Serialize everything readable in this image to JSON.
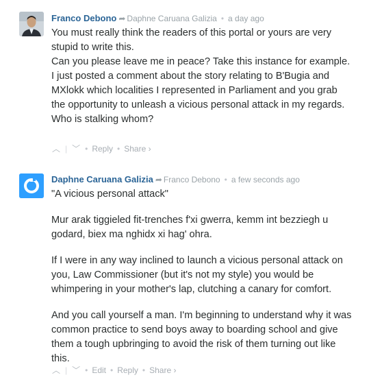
{
  "comments": [
    {
      "author": "Franco Debono",
      "reply_to": "Daphne Caruana Galizia",
      "time": "a day ago",
      "avatar_icon": "user-photo",
      "paragraphs": [
        "You must really think the readers of this portal or yours are very stupid to write this.\nCan you please leave me in peace? Take this instance for example. I just posted a comment about the story relating to B'Bugia and MXlokk which localities I represented in Parliament and you grab the opportunity to unleash a vicious personal attack in my regards.\nWho is stalking whom?"
      ],
      "actions": {
        "reply": "Reply",
        "share": "Share ›"
      }
    },
    {
      "author": "Daphne Caruana Galizia",
      "reply_to": "Franco Debono",
      "time": "a few seconds ago",
      "avatar_icon": "disqus-logo",
      "paragraphs": [
        "\"A vicious personal attack\"",
        "Mur arak tiggieled fit-trenches f'xi gwerra, kemm int bezziegh u godard, biex ma nghidx xi hag' ohra.",
        "If I were in any way inclined to launch a vicious personal attack on you, Law Commissioner (but it's not my style) you would be whimpering in your mother's lap, clutching a canary for comfort.",
        "And you call yourself a man. I'm beginning to understand why it was common practice to send boys away to boarding school and give them a tough upbringing to avoid the risk of them turning out like this."
      ],
      "actions": {
        "edit": "Edit",
        "reply": "Reply",
        "share": "Share ›"
      }
    }
  ],
  "colors": {
    "author": "#2a6496",
    "meta": "#9aa3a8",
    "text": "#2a2e2e",
    "disqus": "#2e9fff"
  }
}
